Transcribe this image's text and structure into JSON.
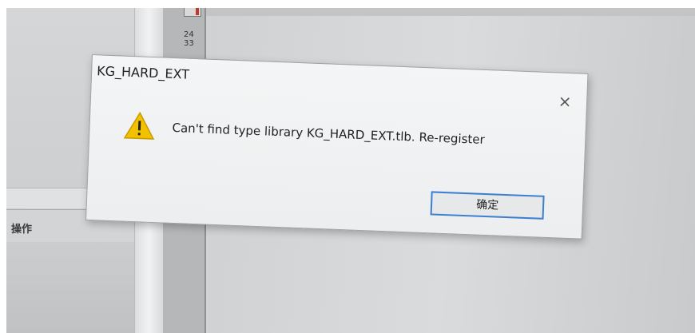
{
  "dialog": {
    "title": "KG_HARD_EXT",
    "message": "Can't find type library KG_HARD_EXT.tlb. Re-register",
    "ok_label": "确定",
    "close_glyph": "×",
    "icon": "warning-icon"
  },
  "background": {
    "table_header_label": "操作",
    "toolbar_glyph": "24\n33"
  },
  "colors": {
    "warning": "#f2c200",
    "button_border": "#3b7fd1"
  }
}
